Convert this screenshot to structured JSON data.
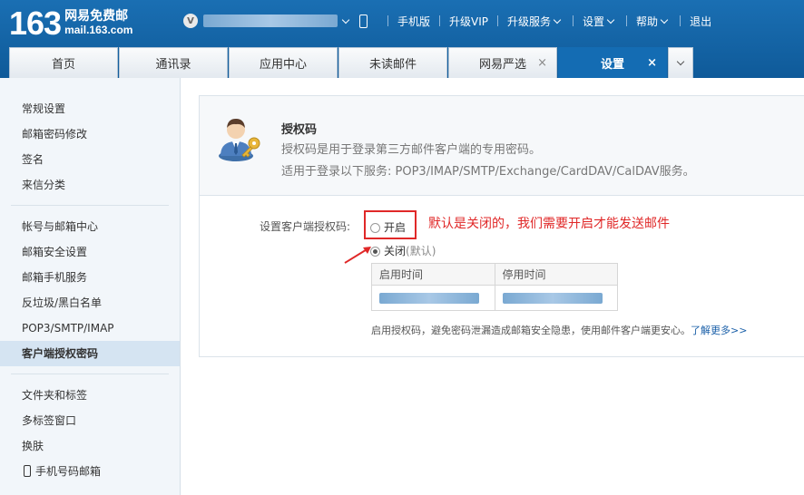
{
  "brand": {
    "number": "163",
    "cn_name": "网易免费邮",
    "domain": "mail.163.com"
  },
  "topbar": {
    "vip_badge": "V",
    "links": [
      "手机版",
      "升级VIP",
      "升级服务",
      "设置",
      "帮助",
      "退出"
    ]
  },
  "tabs": [
    {
      "label": "首页",
      "active": false,
      "closable": false
    },
    {
      "label": "通讯录",
      "active": false,
      "closable": false
    },
    {
      "label": "应用中心",
      "active": false,
      "closable": false
    },
    {
      "label": "未读邮件",
      "active": false,
      "closable": false
    },
    {
      "label": "网易严选",
      "active": false,
      "closable": true
    },
    {
      "label": "设置",
      "active": true,
      "closable": true
    }
  ],
  "close_glyph": "×",
  "sidebar": {
    "group1": [
      "常规设置",
      "邮箱密码修改",
      "签名",
      "来信分类"
    ],
    "group2": [
      "帐号与邮箱中心",
      "邮箱安全设置",
      "邮箱手机服务",
      "反垃圾/黑白名单",
      "POP3/SMTP/IMAP",
      "客户端授权密码"
    ],
    "group3": [
      "文件夹和标签",
      "多标签窗口",
      "换肤",
      "手机号码邮箱"
    ],
    "active": "客户端授权密码"
  },
  "auth": {
    "title": "授权码",
    "desc1": "授权码是用于登录第三方邮件客户端的专用密码。",
    "desc2": "适用于登录以下服务: POP3/IMAP/SMTP/Exchange/CardDAV/CalDAV服务。",
    "setting_label": "设置客户端授权码:",
    "option_on": "开启",
    "option_off": "关闭",
    "option_off_hint": "(默认)",
    "selected": "关闭",
    "annotation": "默认是关闭的，我们需要开启才能发送邮件",
    "table_headers": [
      "启用时间",
      "停用时间"
    ],
    "note": "启用授权码，避免密码泄漏造成邮箱安全隐患，使用邮件客户端更安心。",
    "more_link": "了解更多>>"
  },
  "colors": {
    "header": "#1a6fb3",
    "active_tab": "#146cb3",
    "annotation": "#e02828",
    "link": "#1a5fa8"
  }
}
